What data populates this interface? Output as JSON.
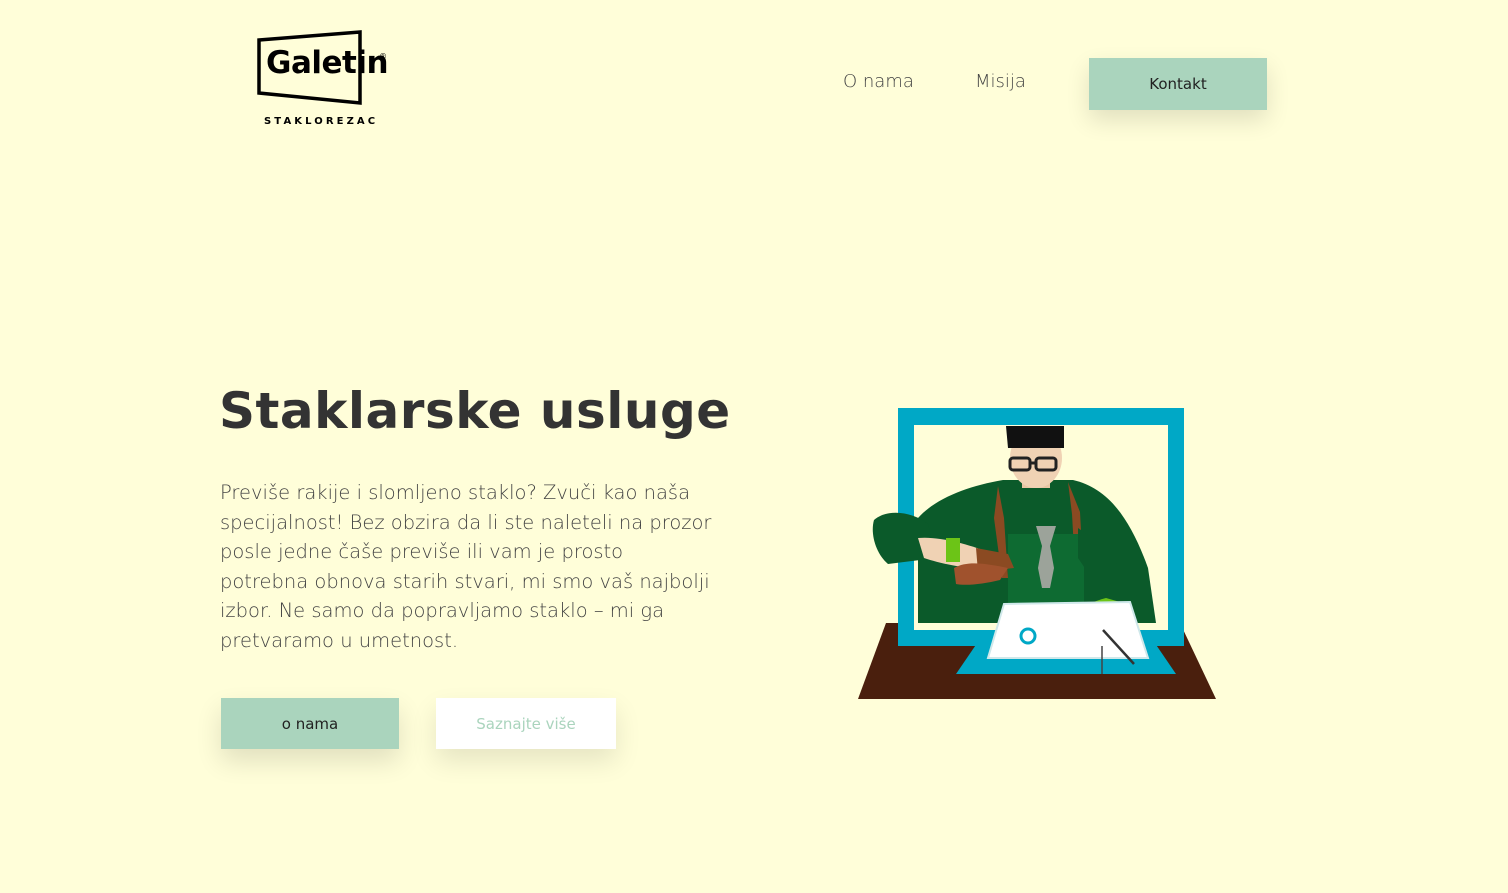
{
  "header": {
    "logo": {
      "name": "Galetin",
      "tagline": "STAKLOREZAC"
    },
    "nav": {
      "items": [
        {
          "label": "O nama"
        },
        {
          "label": "Misija"
        }
      ],
      "contact_button": "Kontakt"
    }
  },
  "hero": {
    "title": "Staklarske usluge",
    "description": "Previše rakije i slomljeno staklo? Zvuči kao naša specijalnost! Bez obzira da li ste naleteli na prozor posle jedne čaše previše ili vam je prosto potrebna obnova starih stvari, mi smo vaš najbolji izbor. Ne samo da popravljamo staklo – mi ga pretvaramo u umetnost.",
    "primary_button": "o nama",
    "secondary_button": "Saznajte više",
    "illustration": "glazier-at-work-illustration"
  },
  "colors": {
    "background": "#fffed9",
    "accent": "#aad4bd",
    "text": "#333333",
    "frame_blue": "#00a8c6",
    "shirt_green": "#0b5a2a",
    "glove_green": "#6cc417",
    "table_brown": "#4a1f0d"
  }
}
